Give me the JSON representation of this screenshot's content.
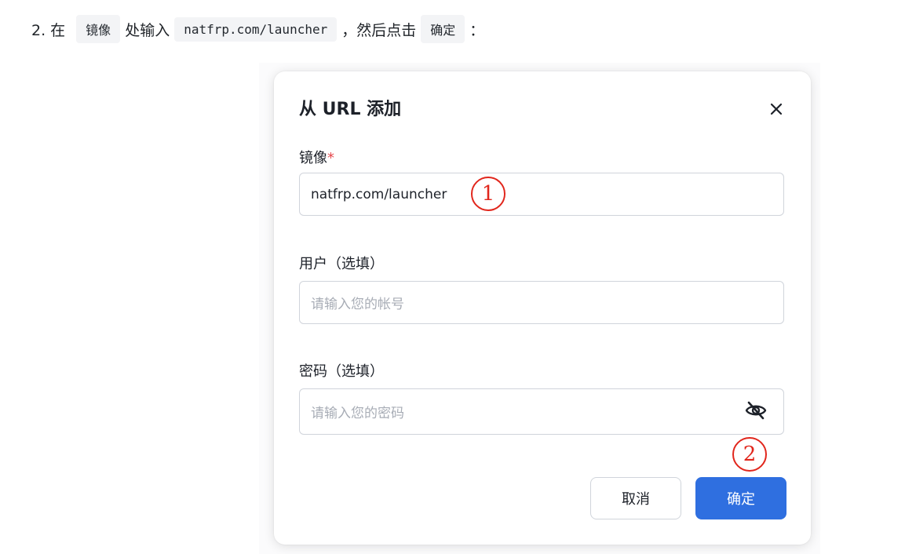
{
  "instruction": {
    "prefix": "2. 在",
    "code1": "镜像",
    "middle": "处输入",
    "code2": "natfrp.com/launcher",
    "after": "，然后点击",
    "code3": "确定",
    "suffix": "："
  },
  "dialog": {
    "title": "从 URL 添加",
    "close_icon": "close-icon",
    "fields": {
      "image": {
        "label": "镜像",
        "required_mark": "*",
        "value": "natfrp.com/launcher"
      },
      "user": {
        "label": "用户（选填）",
        "placeholder": "请输入您的帐号"
      },
      "password": {
        "label": "密码（选填）",
        "placeholder": "请输入您的密码",
        "toggle_icon": "eye-off-icon"
      }
    },
    "buttons": {
      "cancel": "取消",
      "confirm": "确定"
    }
  },
  "annotations": {
    "marker1": "1",
    "marker2": "2",
    "color": "#e1261c"
  },
  "colors": {
    "primary": "#2f6fe0",
    "required": "#e5484d"
  }
}
